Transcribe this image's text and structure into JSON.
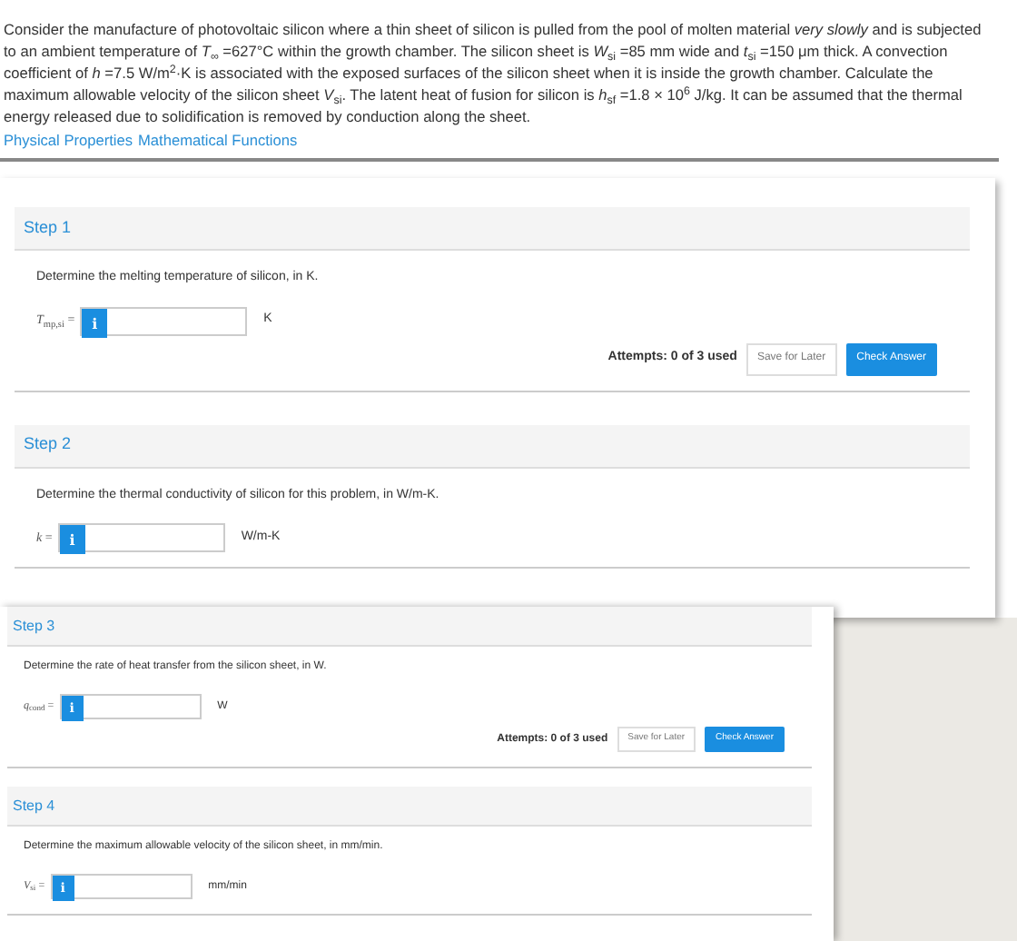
{
  "problem": {
    "text": "Consider the manufacture of photovoltaic silicon where a thin sheet of silicon is pulled from the pool of molten material *very slowly* and is subjected to an ambient temperature of *T*$_{∞}$ =627°C within the growth chamber. The silicon sheet is *W*$_{si}$ =85 mm wide and *t*$_{si}$ =150 μm thick. A convection coefficient of *h* =7.5 W/m$^{2}$·K is associated with the exposed surfaces of the silicon sheet when it is inside the growth chamber. Calculate the maximum allowable velocity of the silicon sheet *V*$_{si}$. The latent heat of fusion for silicon is *h*$_{sf}$ =1.8 × 10$^{6}$ J/kg. It can be assumed that the thermal energy released due to solidification is removed by conduction along the sheet.",
    "links": [
      "Physical Properties",
      "Mathematical Functions"
    ]
  },
  "panels": [
    {
      "steps": [
        {
          "title": "Step 1",
          "prompt": "Determine the melting temperature of silicon, in K.",
          "variable": "*T*$_{mp,si}$ =",
          "info": "i",
          "unit": "K",
          "actions": {
            "attempts": "Attempts: 0 of 3 used",
            "save": "Save for Later",
            "check": "Check Answer"
          }
        },
        {
          "title": "Step 2",
          "prompt": "Determine the thermal conductivity of silicon for this problem, in W/m-K.",
          "variable": "*k* =",
          "info": "i",
          "unit": "W/m-K"
        }
      ]
    },
    {
      "steps": [
        {
          "title": "Step 3",
          "prompt": "Determine the rate of heat transfer from the silicon sheet, in W.",
          "variable": "*q*$_{cond}$ =",
          "info": "i",
          "unit": "W",
          "actions": {
            "attempts": "Attempts: 0 of 3 used",
            "save": "Save for Later",
            "check": "Check Answer"
          }
        },
        {
          "title": "Step 4",
          "prompt": "Determine the maximum allowable velocity of the silicon sheet, in mm/min.",
          "variable": "*V*$_{si}$ =",
          "info": "i",
          "unit": "mm/min"
        }
      ]
    }
  ]
}
